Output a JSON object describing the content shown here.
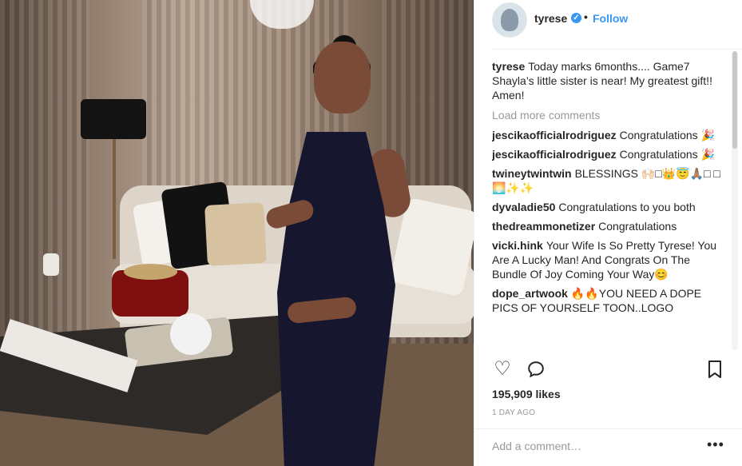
{
  "post": {
    "username": "tyrese",
    "follow_label": "Follow",
    "caption_user": "tyrese",
    "caption_text": "Today marks 6months.... Game7 Shayla’s little sister is near! My greatest gift!! Amen!",
    "load_more": "Load more comments",
    "comments": [
      {
        "user": "jescikaofficialrodriguez",
        "text": "Congratulations 🎉"
      },
      {
        "user": "jescikaofficialrodriguez",
        "text": "Congratulations 🎉"
      },
      {
        "user": "twineytwintwin",
        "text": "BLESSINGS 🙌🏻□👑😇🙏🏽□ □🌅✨✨"
      },
      {
        "user": "dyvaladie50",
        "text": "Congratulations to you both"
      },
      {
        "user": "thedreammonetizer",
        "text": "Congratulations"
      },
      {
        "user": "vicki.hink",
        "text": "Your Wife Is So Pretty Tyrese! You Are A Lucky Man! And Congrats On The Bundle Of Joy Coming Your Way😊"
      },
      {
        "user": "dope_artwook",
        "text": "🔥🔥YOU NEED A DOPE PICS OF YOURSELF TOON..LOGO"
      }
    ],
    "likes": "195,909 likes",
    "time": "1 DAY AGO",
    "add_comment_placeholder": "Add a comment…",
    "more_label": "•••"
  },
  "icons": {
    "avatar": "profile-avatar",
    "verified": "verified-badge-icon",
    "like": "heart-icon",
    "comment": "comment-icon",
    "save": "bookmark-icon",
    "more": "more-options-icon"
  },
  "colors": {
    "brand_blue": "#3897f0",
    "text_primary": "#262626",
    "text_secondary": "#999999",
    "border": "#efefef"
  }
}
